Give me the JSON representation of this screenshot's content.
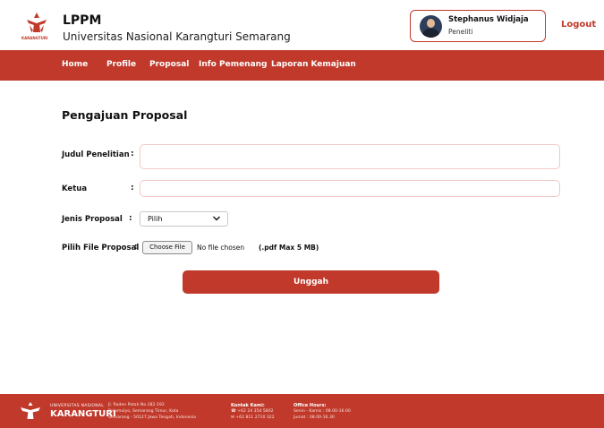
{
  "header": {
    "title": "LPPM",
    "subtitle": "Universitas Nasional Karangturi Semarang",
    "logo_caption": "KARANGTURI",
    "user": {
      "name": "Stephanus Widjaja",
      "role": "Peneliti"
    },
    "logout_label": "Logout"
  },
  "nav": {
    "items": [
      {
        "label": "Home"
      },
      {
        "label": "Profile"
      },
      {
        "label": "Proposal"
      },
      {
        "label": "Info Pemenang"
      },
      {
        "label": "Laporan Kemajuan"
      }
    ]
  },
  "form": {
    "title": "Pengajuan Proposal",
    "judul_label": "Judul Penelitian",
    "judul_value": "",
    "ketua_label": "Ketua",
    "ketua_value": "",
    "jenis_label": "Jenis Proposal",
    "jenis_selected": "Pilih",
    "file_label": "Pilih File Proposal",
    "file_button": "Choose File",
    "file_status": "No file chosen",
    "file_hint": "(.pdf Max 5 MB)",
    "colon": ":",
    "submit_label": "Unggah"
  },
  "footer": {
    "uni_line1": "UNIVERSITAS NASIONAL",
    "uni_line2": "KARANGTURI",
    "address": [
      "Jl. Raden Patah No.182-192",
      "Rejomulyo, Semarang Timur, Kota",
      "Semarang - 50127 Jawa Tengah, Indonesia"
    ],
    "contact_title": "Kontak Kami:",
    "contact": [
      "☎ +62 24 354 5802",
      "✉ +62 811 2710 322"
    ],
    "hours_title": "Office Hours:",
    "hours": [
      "Senin - Kamis : 08.00-16.00",
      "Jumat : 08.00-16.30"
    ]
  },
  "colors": {
    "accent": "#c0392b"
  }
}
